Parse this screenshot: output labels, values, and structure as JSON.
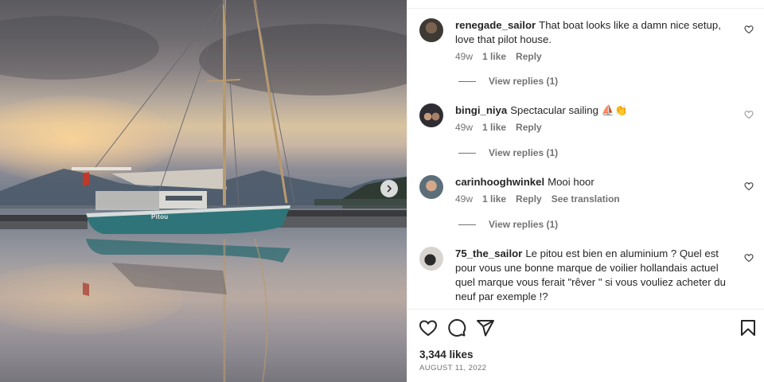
{
  "post": {
    "boat_name": "Pitou"
  },
  "comments": [
    {
      "username": "renegade_sailor",
      "text": "That boat looks like a damn nice setup, love that pilot house.",
      "time": "49w",
      "likes": "1 like",
      "reply_label": "Reply",
      "view_replies": "View replies (1)"
    },
    {
      "username": "bingi_niya",
      "text": "Spectacular sailing ⛵👏",
      "time": "49w",
      "likes": "1 like",
      "reply_label": "Reply",
      "view_replies": "View replies (1)"
    },
    {
      "username": "carinhooghwinkel",
      "text": "Mooi hoor",
      "time": "49w",
      "likes": "1 like",
      "reply_label": "Reply",
      "translation_label": "See translation",
      "view_replies": "View replies (1)"
    },
    {
      "username": "75_the_sailor",
      "text": "Le pitou est bien en aluminium ? Quel est pour vous une bonne marque de voilier hollandais actuel quel marque vous ferait \"rêver \" si vous vouliez acheter du neuf par exemple !?"
    }
  ],
  "footer": {
    "likes": "3,344 likes",
    "date": "AUGUST 11, 2022"
  },
  "icons": {
    "like": "heart-icon",
    "comment": "comment-icon",
    "share": "share-icon",
    "save": "bookmark-icon",
    "next": "chevron-right-icon"
  }
}
